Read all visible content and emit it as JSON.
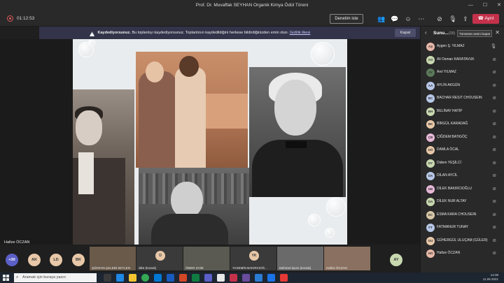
{
  "window": {
    "title": "Prof. Dr. Muvaffak SEYHAN Organik Kimya Ödül Töreni",
    "controls": [
      "—",
      "☐",
      "✕"
    ]
  },
  "toolbar": {
    "timer": "01:12:53",
    "review_label": "Denetim iste",
    "leave_label": "Ayrıl",
    "icons": [
      "people-icon",
      "chat-icon",
      "reaction-icon",
      "more-icon",
      "camera-off-icon",
      "mic-icon",
      "share-icon"
    ]
  },
  "banner": {
    "title": "Kaydediyorsunuz.",
    "text": "Bu toplantıyı kaydediyorsunuz. Toplantının kaydedildiğini herkese bildirdiğinizden emin olun.",
    "link": "Gizlilik ilkesi",
    "close_label": "Kapat"
  },
  "presenter": {
    "name": "Hafize ÖCZAN"
  },
  "panel": {
    "title": "Sunu...",
    "count": "(15)",
    "mute_all_label": "Tümünün sesini kapat",
    "participants": [
      {
        "initials": "AŞ",
        "name": "Aygen Ş. YILMAZ",
        "color": "#e8b8a8",
        "mic": "on"
      },
      {
        "initials": "AO",
        "name": "Ali Osman KARATAVUK",
        "color": "#c8d8b0",
        "mic": "off"
      },
      {
        "initials": "AY",
        "name": "Anıl YILMAZ",
        "color": "#5a7a5a",
        "mic": "off"
      },
      {
        "initials": "AA",
        "name": "AYLİN AKGÜN",
        "color": "#b8c8e8",
        "mic": "off"
      },
      {
        "initials": "BC",
        "name": "BACHAR RESIT CHOUSEIN",
        "color": "#b8c8e8",
        "mic": "off"
      },
      {
        "initials": "BH",
        "name": "BELİNAY HATİP",
        "color": "#c8d8b0",
        "mic": "off"
      },
      {
        "initials": "BK",
        "name": "BİRGÜL KARADAĞ",
        "color": "#e8c8a8",
        "mic": "off"
      },
      {
        "initials": "ÇB",
        "name": "ÇİĞDEM BATIGÖÇ",
        "color": "#e8b8d8",
        "mic": "off"
      },
      {
        "initials": "DÖ",
        "name": "DAMLA ÖCAL",
        "color": "#e8c8a8",
        "mic": "off"
      },
      {
        "initials": "DY",
        "name": "Didem YEŞİLCİ",
        "color": "#c8d8b0",
        "mic": "off"
      },
      {
        "initials": "DA",
        "name": "DİLAN AYCİL",
        "color": "#b8c8e8",
        "mic": "off"
      },
      {
        "initials": "DB",
        "name": "DİLEK BAKIRCIOĞLU",
        "color": "#e8b8d8",
        "mic": "off"
      },
      {
        "initials": "DA",
        "name": "DİLEK NUR ALTAY",
        "color": "#c8d8b0",
        "mic": "off"
      },
      {
        "initials": "EC",
        "name": "ESMA KARA CHOUSEIN",
        "color": "#d8c8a8",
        "mic": "off"
      },
      {
        "initials": "FT",
        "name": "FATMANUR TUNAY",
        "color": "#b8c8e8",
        "mic": "off"
      },
      {
        "initials": "GU",
        "name": "GÜHERGÜL ULUÇAM (GÜLER)",
        "color": "#e8c8a8",
        "mic": "off"
      },
      {
        "initials": "HÖ",
        "name": "Hafize ÖCZAN",
        "color": "#e8b8a8",
        "mic": "off"
      }
    ]
  },
  "gallery": {
    "overflow": "+30",
    "circles": [
      {
        "initials": "AK",
        "color": "#e8c8a8"
      },
      {
        "initials": "LD",
        "color": "#e8c8a8"
      },
      {
        "initials": "BK",
        "color": "#e8c8a8"
      }
    ],
    "tiles": [
      {
        "label": "ŞÜKRAN ÇELEBİ SEYLEN",
        "initials": "",
        "bg": "#6a5a4a"
      },
      {
        "label": "ülkü (Konuk)",
        "initials": "Ü",
        "bg": "#3a3a3a"
      },
      {
        "label": "ÖMER ZAİM",
        "initials": "",
        "bg": "#5a5a52"
      },
      {
        "label": "YASEMİN BAKIRCIOĞ...",
        "initials": "YK",
        "bg": "#3a3a3a"
      },
      {
        "label": "Mehmet İşcan (Konuk)",
        "initials": "",
        "bg": "#6a6a6a"
      },
      {
        "label": "Hafize ÖCZAN",
        "initials": "",
        "bg": "#8a7060"
      }
    ],
    "last_circle": {
      "initials": "AY",
      "color": "#c8d8b0"
    }
  },
  "taskbar": {
    "search_placeholder": "Aramak için buraya yazın",
    "time": "14:38",
    "date": "11.06.2021"
  }
}
